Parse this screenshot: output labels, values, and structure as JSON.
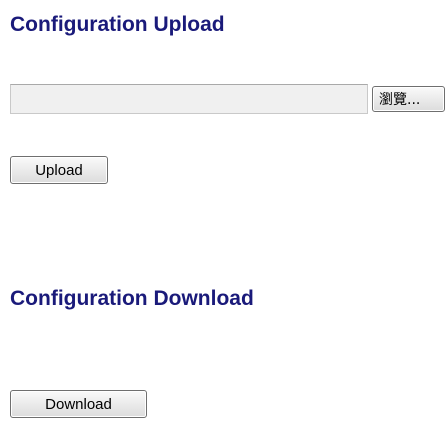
{
  "upload": {
    "title": "Configuration Upload",
    "file_input": {
      "value": "",
      "browse_label": "瀏覽..."
    },
    "upload_label": "Upload"
  },
  "download": {
    "title": "Configuration Download",
    "download_label": "Download"
  },
  "colors": {
    "heading": "#1a1a7a",
    "input_background": "#f0f0f0",
    "button_border": "#6f6f6f"
  }
}
